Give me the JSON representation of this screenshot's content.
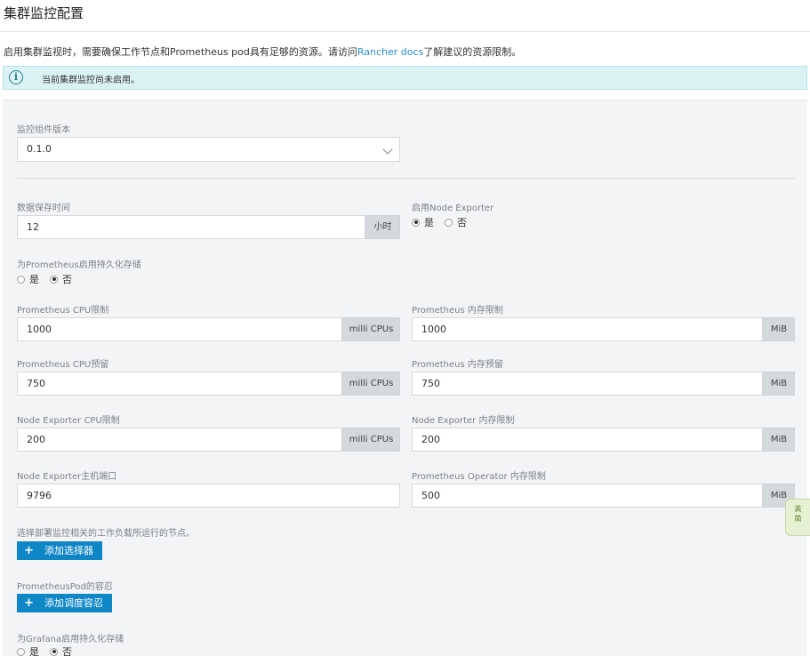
{
  "title": "集群监控配置",
  "intro": {
    "prefix": "启用集群监视时，需要确保工作节点和Prometheus pod具有足够的资源。请访问",
    "link": "Rancher docs",
    "suffix": "了解建议的资源限制。"
  },
  "alert": {
    "text": "当前集群监控尚未启用。"
  },
  "version": {
    "label": "监控组件版本",
    "value": "0.1.0"
  },
  "retention": {
    "label": "数据保存时间",
    "value": "12",
    "unit": "小时"
  },
  "node_exporter_enable": {
    "label": "启用Node Exporter",
    "options": [
      "是",
      "否"
    ],
    "selected": "是"
  },
  "prometheus_persistent": {
    "label": "为Prometheus启用持久化存储",
    "options": [
      "是",
      "否"
    ],
    "selected": "否"
  },
  "prom_cpu_limit": {
    "label": "Prometheus CPU限制",
    "value": "1000",
    "unit": "milli CPUs"
  },
  "prom_mem_limit": {
    "label": "Prometheus 内存限制",
    "value": "1000",
    "unit": "MiB"
  },
  "prom_cpu_reserve": {
    "label": "Prometheus CPU预留",
    "value": "750",
    "unit": "milli CPUs"
  },
  "prom_mem_reserve": {
    "label": "Prometheus 内存预留",
    "value": "750",
    "unit": "MiB"
  },
  "ne_cpu_limit": {
    "label": "Node Exporter CPU限制",
    "value": "200",
    "unit": "milli CPUs"
  },
  "ne_mem_limit": {
    "label": "Node Exporter 内存限制",
    "value": "200",
    "unit": "MiB"
  },
  "ne_port": {
    "label": "Node Exporter主机端口",
    "value": "9796"
  },
  "operator_mem_limit": {
    "label": "Prometheus Operator 内存限制",
    "value": "500",
    "unit": "MiB"
  },
  "node_selector": {
    "label": "选择部署监控相关的工作负载所运行的节点。",
    "button": "添加选择器"
  },
  "tolerations": {
    "label": "PrometheusPod的容忍",
    "button": "添加调度容忍"
  },
  "grafana_persistent": {
    "label": "为Grafana启用持久化存储",
    "options": [
      "是",
      "否"
    ],
    "selected": "否"
  },
  "ime": {
    "line1": "英",
    "line2": "简"
  },
  "colors": {
    "primary_button": "#0f86c6",
    "link": "#2b8dd6",
    "alert_bg": "#daf2f4"
  }
}
